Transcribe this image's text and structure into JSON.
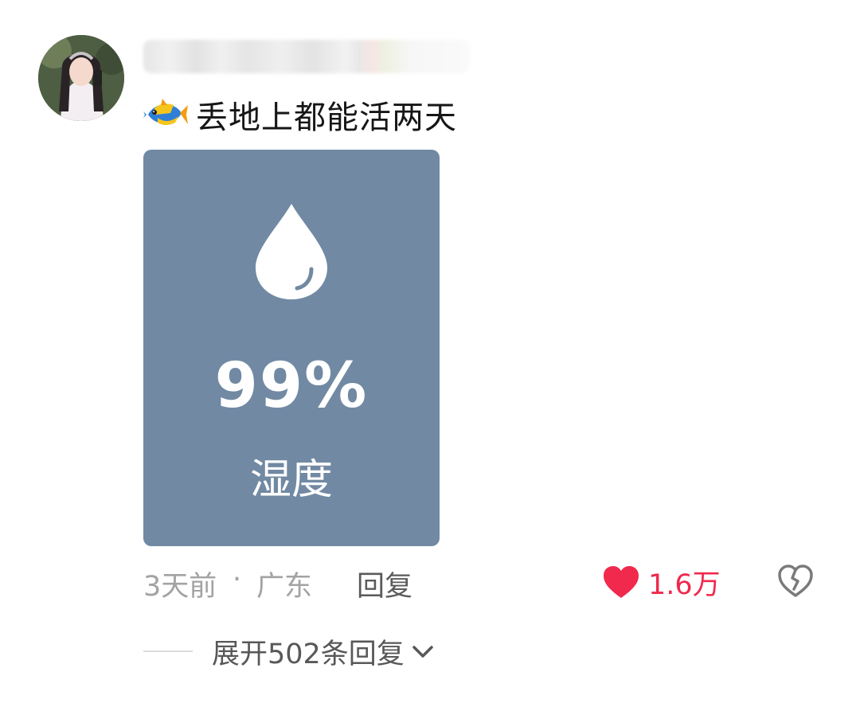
{
  "comment": {
    "username": "",
    "text": "丢地上都能活两天",
    "fish_emoji_icon": "tropical-fish-icon"
  },
  "image": {
    "value": "99%",
    "label": "湿度",
    "icon": "water-drop-icon",
    "background_color": "#7189a3"
  },
  "meta": {
    "time": "3天前",
    "separator": "·",
    "location": "广东",
    "reply_label": "回复"
  },
  "actions": {
    "like_count": "1.6万",
    "like_icon": "heart-icon",
    "like_color": "#f0294d",
    "dislike_icon": "broken-heart-icon"
  },
  "replies": {
    "expand_label": "展开502条回复",
    "expand_icon": "chevron-down-icon"
  }
}
